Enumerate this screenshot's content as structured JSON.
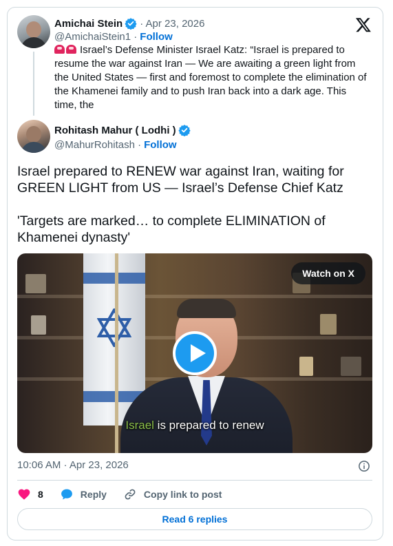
{
  "quoted_tweet": {
    "author_name": "Amichai Stein",
    "date": "· Apr 23, 2026",
    "handle": "@AmichaiStein1 · ",
    "follow_label": "Follow",
    "text": "Israel’s Defense Minister Israel Katz: “Israel is prepared to resume the war against Iran — We are awaiting a green light from the United States — first and foremost to complete the elimination of the Khamenei family and to push Iran back into a dark age. This time, the",
    "emoji_icons": [
      "siren-icon",
      "siren-icon"
    ]
  },
  "main_tweet": {
    "author_name": "Rohitash Mahur ( Lodhi )",
    "handle": "@MahurRohitash · ",
    "follow_label": "Follow",
    "paragraph_1": "Israel prepared to RENEW war against Iran, waiting for GREEN LIGHT from US — Israel’s Defense Chief Katz",
    "paragraph_2": "'Targets are marked… to complete ELIMINATION of Khamenei dynasty'",
    "media": {
      "watch_label": "Watch on X",
      "caption_highlight": "Israel",
      "caption_rest": " is prepared to renew"
    },
    "timestamp": "10:06 AM · Apr 23, 2026",
    "likes_count": "8",
    "reply_label": "Reply",
    "copy_link_label": "Copy link to post",
    "read_replies_label": "Read 6 replies"
  },
  "colors": {
    "accent_blue": "#1d9bf0",
    "link_blue": "#006fd6",
    "like_pink": "#f91880",
    "text_dark": "#0f1419",
    "text_muted": "#536471",
    "border": "#cfd9de"
  }
}
